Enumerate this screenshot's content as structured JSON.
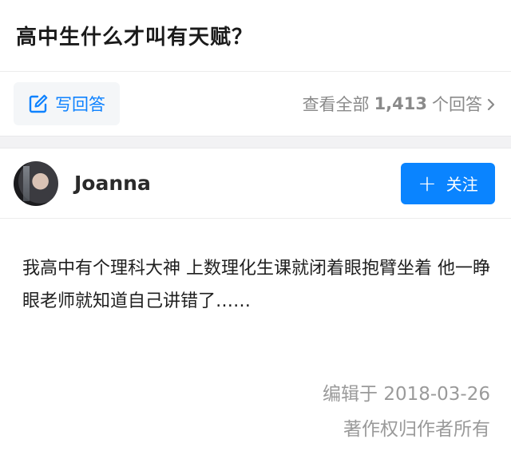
{
  "question": {
    "title": "高中生什么才叫有天赋？"
  },
  "actions": {
    "write_answer_label": "写回答",
    "view_all_prefix": "查看全部",
    "answer_count": "1,413",
    "view_all_suffix": "个回答",
    "accent_color": "#0a84ff"
  },
  "author": {
    "name": "Joanna",
    "follow_label": "关注"
  },
  "answer": {
    "text": "我高中有个理科大神 上数理化生课就闭着眼抱臂坐着 他一睁眼老师就知道自己讲错了……"
  },
  "meta": {
    "edited": "编辑于 2018-03-26",
    "copyright": "著作权归作者所有"
  },
  "icons": {
    "write": "edit-pencil-icon",
    "chevron": "chevron-right-icon",
    "plus": "plus-icon"
  }
}
